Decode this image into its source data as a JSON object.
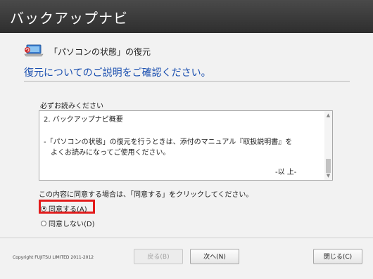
{
  "window": {
    "title": "バックアップナビ"
  },
  "section": {
    "icon": "laptop-restore-icon",
    "label": "「パソコンの状態」の復元"
  },
  "heading": "復元についてのご説明をご確認ください。",
  "notice": {
    "label": "必ずお読みください",
    "lines": [
      "2. バックアップナビ概要",
      "-「パソコンの状態」の復元を行うときは、添付のマニュアル『取扱説明書』を",
      "よくお読みになってご使用ください。",
      "-以 上-"
    ]
  },
  "agreement": {
    "prompt": "この内容に同意する場合は、「同意する」をクリックしてください。",
    "options": [
      {
        "label": "同意する(A)",
        "selected": true
      },
      {
        "label": "同意しない(D)",
        "selected": false
      }
    ]
  },
  "footer": {
    "copyright": "Copyright FUJITSU LIMITED 2011-2012",
    "back_label": "戻る(B)",
    "next_label": "次へ(N)",
    "close_label": "閉じる(C)"
  },
  "colors": {
    "heading": "#1a4fb0",
    "highlight": "#e31b1b",
    "titlebar": "#333333"
  }
}
